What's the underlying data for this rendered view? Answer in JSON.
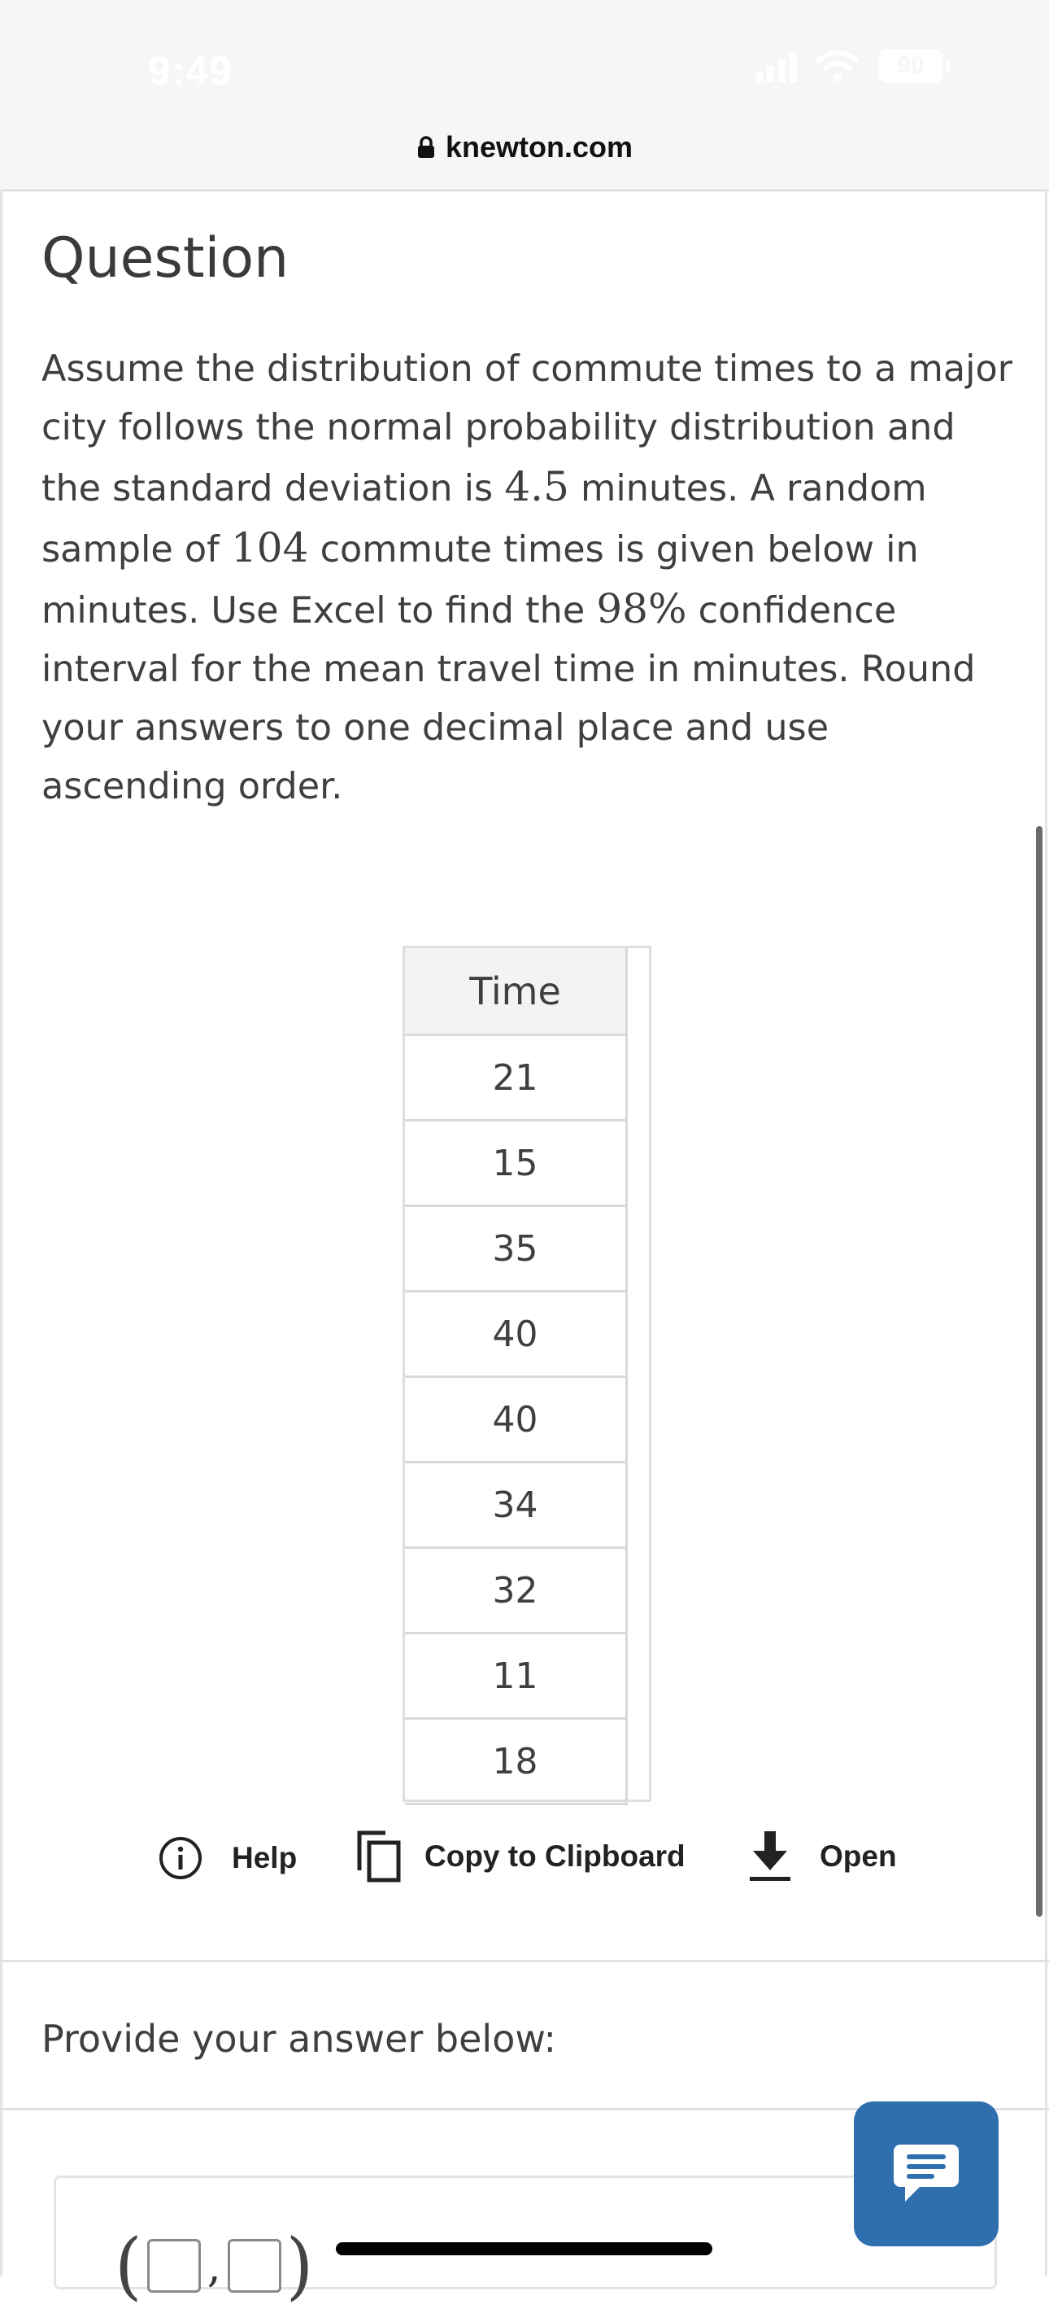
{
  "status_bar": {
    "time": "9:49",
    "battery": "90"
  },
  "url_bar": {
    "domain": "knewton.com"
  },
  "question": {
    "heading": "Question",
    "text_parts": [
      "Assume the distribution of commute times to a major city follows the normal probability distribution and the standard deviation is ",
      "4.5",
      " minutes. A random sample of ",
      "104",
      " commute times is given below in minutes. Use Excel to find the ",
      "98%",
      " confidence interval for the mean travel time in minutes. Round your answers to one decimal place and use ascending order."
    ]
  },
  "table": {
    "header": "Time",
    "rows": [
      "21",
      "15",
      "35",
      "40",
      "40",
      "34",
      "32",
      "11",
      "18"
    ]
  },
  "actions": {
    "help_label": "Help",
    "copy_label": "Copy to Clipboard",
    "open_label": "Open"
  },
  "answer": {
    "prompt": "Provide your answer below:",
    "open_paren": "(",
    "comma": ",",
    "close_paren": ")"
  },
  "icons": {
    "lock": "lock-icon",
    "help": "info-circle-icon",
    "copy": "copy-icon",
    "open": "download-icon",
    "chat": "chat-bubble-icon",
    "wifi": "wifi-icon",
    "signal": "signal-icon",
    "battery": "battery-icon"
  },
  "colors": {
    "accent": "#2f6fae",
    "text": "#3f3f3f"
  }
}
